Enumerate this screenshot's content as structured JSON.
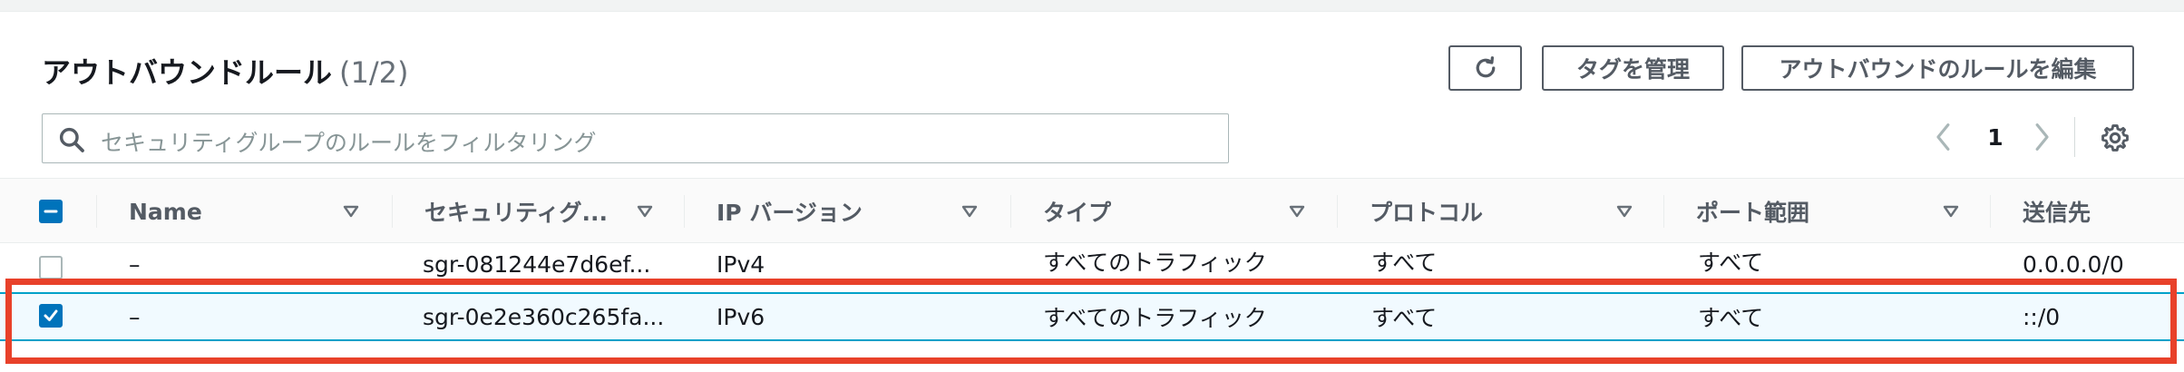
{
  "header": {
    "title": "アウトバウンドルール",
    "count": "(1/2)"
  },
  "toolbar": {
    "refresh_icon": "refresh-icon",
    "manage_tags_label": "タグを管理",
    "edit_outbound_label": "アウトバウンドのルールを編集"
  },
  "search": {
    "placeholder": "セキュリティグループのルールをフィルタリング",
    "icon": "search-icon"
  },
  "pagination": {
    "current_page": "1"
  },
  "table": {
    "columns": [
      "Name",
      "セキュリティグ...",
      "IP バージョン",
      "タイプ",
      "プロトコル",
      "ポート範囲",
      "送信先"
    ],
    "rows": [
      {
        "selected": false,
        "name": "–",
        "security_group_rule_id": "sgr-081244e7d6ef...",
        "ip_version": "IPv4",
        "type": "すべてのトラフィック",
        "protocol": "すべて",
        "port_range": "すべて",
        "destination": "0.0.0.0/0"
      },
      {
        "selected": true,
        "name": "–",
        "security_group_rule_id": "sgr-0e2e360c265fa...",
        "ip_version": "IPv6",
        "type": "すべてのトラフィック",
        "protocol": "すべて",
        "port_range": "すべて",
        "destination": "::/0"
      }
    ]
  },
  "colors": {
    "primary": "#0073bb",
    "selected_row_bg": "#f1faff",
    "selected_row_border": "#00a1c9",
    "highlight_box": "#e8412a"
  }
}
